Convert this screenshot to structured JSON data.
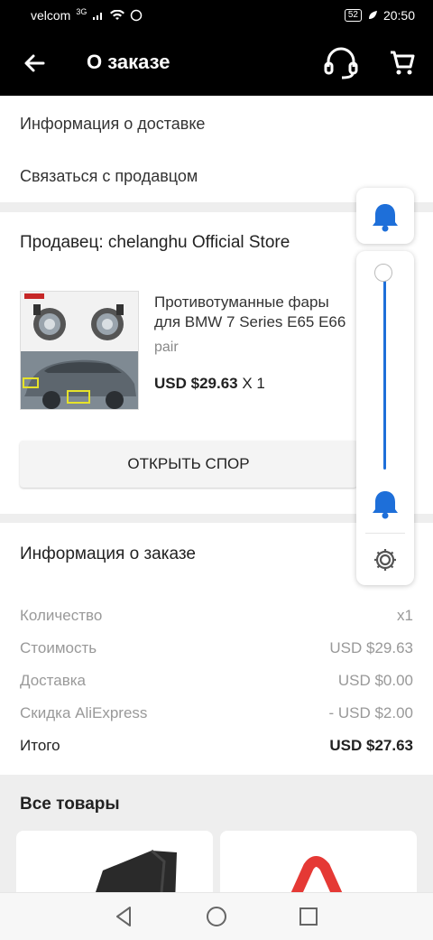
{
  "status_bar": {
    "carrier": "velcom",
    "network": "3G",
    "battery": "52",
    "time": "20:50"
  },
  "header": {
    "title": "О заказе",
    "back_icon": "arrow-left-icon",
    "support_icon": "headset-icon",
    "cart_icon": "shopping-cart-icon"
  },
  "links": {
    "delivery_info": "Информация о доставке",
    "contact_seller": "Связаться с продавцом"
  },
  "seller": {
    "label": "Продавец: chelanghu Official Store"
  },
  "product": {
    "title": "Противотуманные фары для BMW 7 Series E65 E66",
    "variant": "pair",
    "price": "USD $29.63",
    "qty": "X 1"
  },
  "dispute_button": "ОТКРЫТЬ СПОР",
  "order_info": {
    "title": "Информация о заказе",
    "rows": [
      {
        "label": "Количество",
        "value": "x1"
      },
      {
        "label": "Стоимость",
        "value": "USD $29.63"
      },
      {
        "label": "Доставка",
        "value": "USD $0.00"
      },
      {
        "label": "Скидка AliExpress",
        "value": "- USD $2.00"
      },
      {
        "label": "Итого",
        "value": "USD $27.63"
      }
    ]
  },
  "all_goods": {
    "title": "Все товары"
  },
  "volume_panel": {
    "level": 0.98,
    "accent_color": "#1e6fd9"
  },
  "colors": {
    "header_bg": "#000000",
    "accent": "#1e6fd9",
    "section_gap": "#eeeeee"
  }
}
